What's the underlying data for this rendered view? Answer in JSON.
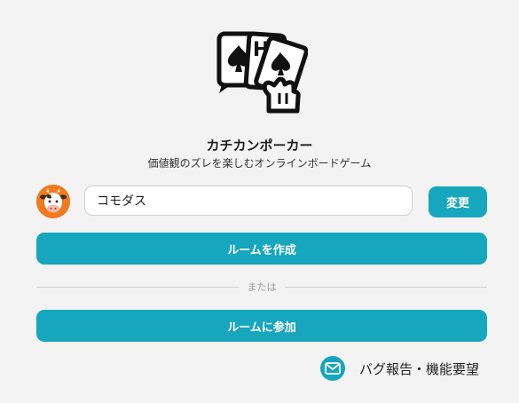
{
  "app": {
    "title": "カチカンポーカー",
    "subtitle": "価値観のズレを楽しむオンラインボードゲーム"
  },
  "icons": {
    "logo": "cards-in-hand-icon",
    "avatar": "cow-avatar-icon",
    "feedback": "mail-icon"
  },
  "colors": {
    "accent": "#16a6bd",
    "background": "#f3f3f3",
    "avatar_bg": "#f07a1e"
  },
  "profile": {
    "name_value": "コモダス",
    "change_label": "変更"
  },
  "actions": {
    "create_room_label": "ルームを作成",
    "or_label": "または",
    "join_room_label": "ルームに参加"
  },
  "footer": {
    "feedback_label": "バグ報告・機能要望"
  }
}
